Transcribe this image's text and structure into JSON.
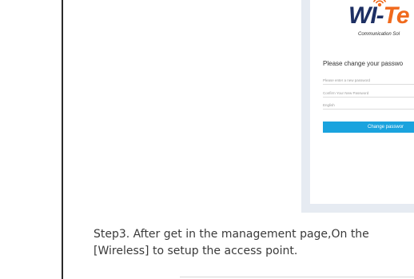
{
  "login_screenshot": {
    "logo": {
      "brand_main": "WI-",
      "brand_accent": "Te",
      "tagline": "Communication Sol"
    },
    "form": {
      "title": "Please change your passwo",
      "new_password_placeholder": "Please enter a new password",
      "confirm_password_placeholder": "Confirm Your New Password",
      "language_value": "English",
      "submit_label": "Change passwor"
    }
  },
  "step": {
    "line1": "Step3. After get in the management page,On the",
    "line2": "[Wireless] to setup the access point."
  },
  "colors": {
    "brand_navy": "#1d2f63",
    "brand_orange": "#f06a1d",
    "button_blue": "#1aa3de",
    "frame_bg": "#e6ebf2"
  }
}
